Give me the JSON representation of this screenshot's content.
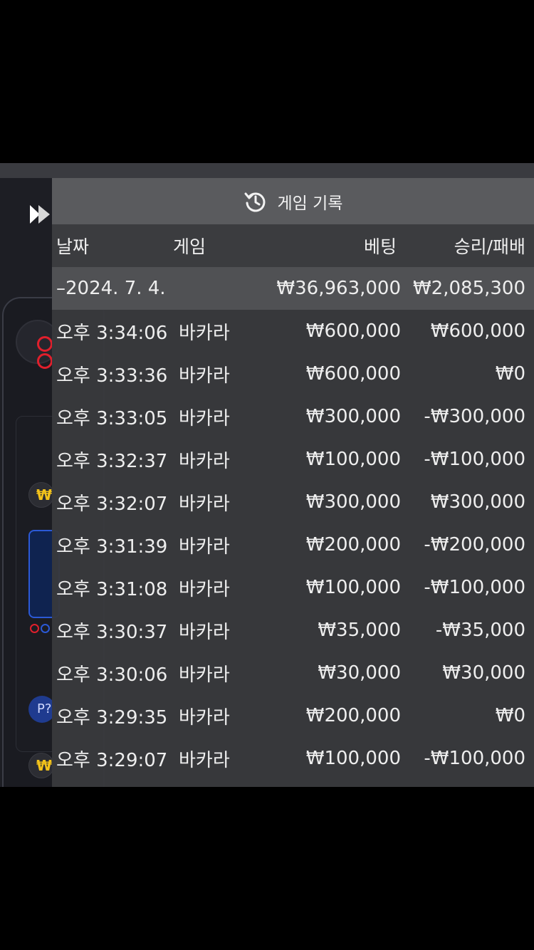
{
  "panel": {
    "title": "게임 기록",
    "icon": "history-icon",
    "columns": {
      "date": "날짜",
      "game": "게임",
      "bet": "베팅",
      "result": "승리/패배"
    },
    "summary": {
      "date": "–2024. 7. 4.",
      "bet": "₩36,963,000",
      "result": "₩2,085,300"
    },
    "rows": [
      {
        "time": "오후 3:34:06",
        "game": "바카라",
        "bet": "₩600,000",
        "result": "₩600,000"
      },
      {
        "time": "오후 3:33:36",
        "game": "바카라",
        "bet": "₩600,000",
        "result": "₩0"
      },
      {
        "time": "오후 3:33:05",
        "game": "바카라",
        "bet": "₩300,000",
        "result": "-₩300,000"
      },
      {
        "time": "오후 3:32:37",
        "game": "바카라",
        "bet": "₩100,000",
        "result": "-₩100,000"
      },
      {
        "time": "오후 3:32:07",
        "game": "바카라",
        "bet": "₩300,000",
        "result": "₩300,000"
      },
      {
        "time": "오후 3:31:39",
        "game": "바카라",
        "bet": "₩200,000",
        "result": "-₩200,000"
      },
      {
        "time": "오후 3:31:08",
        "game": "바카라",
        "bet": "₩100,000",
        "result": "-₩100,000"
      },
      {
        "time": "오후 3:30:37",
        "game": "바카라",
        "bet": "₩35,000",
        "result": "-₩35,000"
      },
      {
        "time": "오후 3:30:06",
        "game": "바카라",
        "bet": "₩30,000",
        "result": "₩30,000"
      },
      {
        "time": "오후 3:29:35",
        "game": "바카라",
        "bet": "₩200,000",
        "result": "₩0"
      },
      {
        "time": "오후 3:29:07",
        "game": "바카라",
        "bet": "₩100,000",
        "result": "-₩100,000"
      }
    ]
  },
  "background": {
    "coin_symbol": "₩",
    "badge_text": "P?"
  }
}
